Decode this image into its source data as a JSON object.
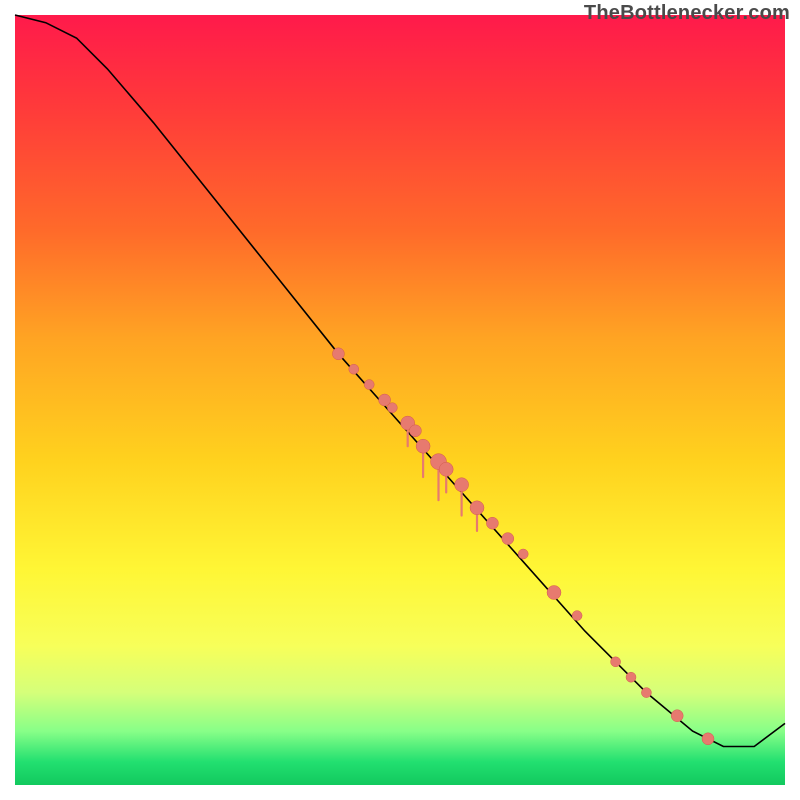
{
  "attribution": "TheBottlenecker.com",
  "chart_data": {
    "type": "line",
    "title": "",
    "xlabel": "",
    "ylabel": "",
    "xlim": [
      0,
      100
    ],
    "ylim": [
      0,
      100
    ],
    "grid": false,
    "legend": false,
    "background_gradient": [
      "#ff1a4b",
      "#ff6a2a",
      "#ffd21e",
      "#fff635",
      "#88ff88",
      "#12c95e"
    ],
    "series": [
      {
        "name": "curve",
        "x": [
          0,
          4,
          8,
          12,
          18,
          26,
          34,
          42,
          50,
          58,
          66,
          74,
          82,
          88,
          92,
          96,
          100
        ],
        "y": [
          100,
          99,
          97,
          93,
          86,
          76,
          66,
          56,
          47,
          38,
          29,
          20,
          12,
          7,
          5,
          5,
          8
        ]
      }
    ],
    "points": [
      {
        "x": 42,
        "y": 56,
        "r": 6
      },
      {
        "x": 44,
        "y": 54,
        "r": 5
      },
      {
        "x": 46,
        "y": 52,
        "r": 5
      },
      {
        "x": 48,
        "y": 50,
        "r": 6
      },
      {
        "x": 49,
        "y": 49,
        "r": 5
      },
      {
        "x": 51,
        "y": 47,
        "r": 7
      },
      {
        "x": 52,
        "y": 46,
        "r": 6
      },
      {
        "x": 53,
        "y": 44,
        "r": 7
      },
      {
        "x": 55,
        "y": 42,
        "r": 8
      },
      {
        "x": 56,
        "y": 41,
        "r": 7
      },
      {
        "x": 58,
        "y": 39,
        "r": 7
      },
      {
        "x": 60,
        "y": 36,
        "r": 7
      },
      {
        "x": 62,
        "y": 34,
        "r": 6
      },
      {
        "x": 64,
        "y": 32,
        "r": 6
      },
      {
        "x": 66,
        "y": 30,
        "r": 5
      },
      {
        "x": 70,
        "y": 25,
        "r": 7
      },
      {
        "x": 73,
        "y": 22,
        "r": 5
      },
      {
        "x": 78,
        "y": 16,
        "r": 5
      },
      {
        "x": 80,
        "y": 14,
        "r": 5
      },
      {
        "x": 82,
        "y": 12,
        "r": 5
      },
      {
        "x": 86,
        "y": 9,
        "r": 6
      },
      {
        "x": 90,
        "y": 6,
        "r": 6
      }
    ],
    "drips": [
      {
        "x": 51,
        "y": 47,
        "len": 3
      },
      {
        "x": 53,
        "y": 44,
        "len": 4
      },
      {
        "x": 55,
        "y": 42,
        "len": 5
      },
      {
        "x": 56,
        "y": 41,
        "len": 3
      },
      {
        "x": 58,
        "y": 39,
        "len": 4
      },
      {
        "x": 60,
        "y": 36,
        "len": 3
      }
    ]
  }
}
